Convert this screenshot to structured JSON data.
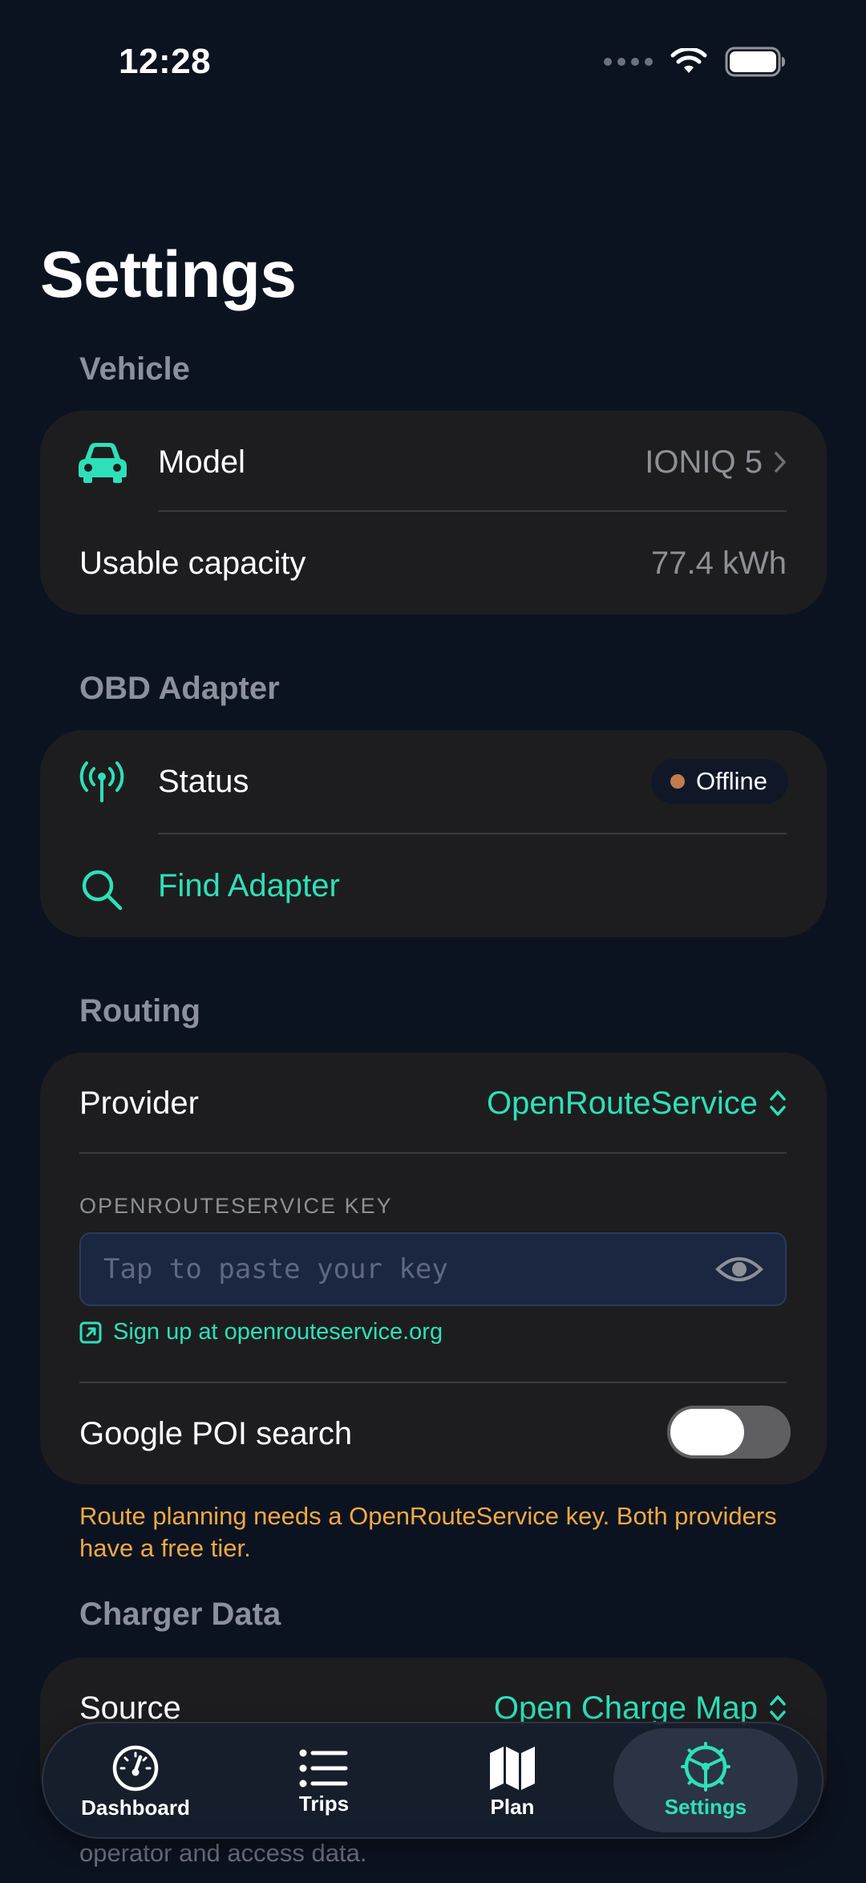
{
  "status_bar": {
    "time": "12:28"
  },
  "page_title": "Settings",
  "vehicle": {
    "header": "Vehicle",
    "model_label": "Model",
    "model_value": "IONIQ 5",
    "capacity_label": "Usable capacity",
    "capacity_value": "77.4 kWh"
  },
  "obd": {
    "header": "OBD Adapter",
    "status_label": "Status",
    "status_value": "Offline",
    "find_label": "Find Adapter"
  },
  "routing": {
    "header": "Routing",
    "provider_label": "Provider",
    "provider_value": "OpenRouteService",
    "key_caption": "OPENROUTESERVICE KEY",
    "key_placeholder": "Tap to paste your key",
    "signup_link": "Sign up at openrouteservice.org",
    "poi_label": "Google POI search",
    "poi_enabled": false,
    "warning": "Route planning needs a OpenRouteService key. Both providers have a free tier."
  },
  "charger": {
    "header": "Charger Data",
    "source_label": "Source",
    "source_value": "Open Charge Map",
    "footer_partial": "operator and access data."
  },
  "tabs": [
    {
      "label": "Dashboard",
      "icon": "gauge-icon"
    },
    {
      "label": "Trips",
      "icon": "list-icon"
    },
    {
      "label": "Plan",
      "icon": "map-icon"
    },
    {
      "label": "Settings",
      "icon": "steering-wheel-icon",
      "active": true
    }
  ],
  "colors": {
    "background": "#0c1320",
    "card": "#1d1d1f",
    "accent": "#2ee0b8",
    "warning": "#f0a944",
    "offline_dot": "#c27a4e"
  }
}
